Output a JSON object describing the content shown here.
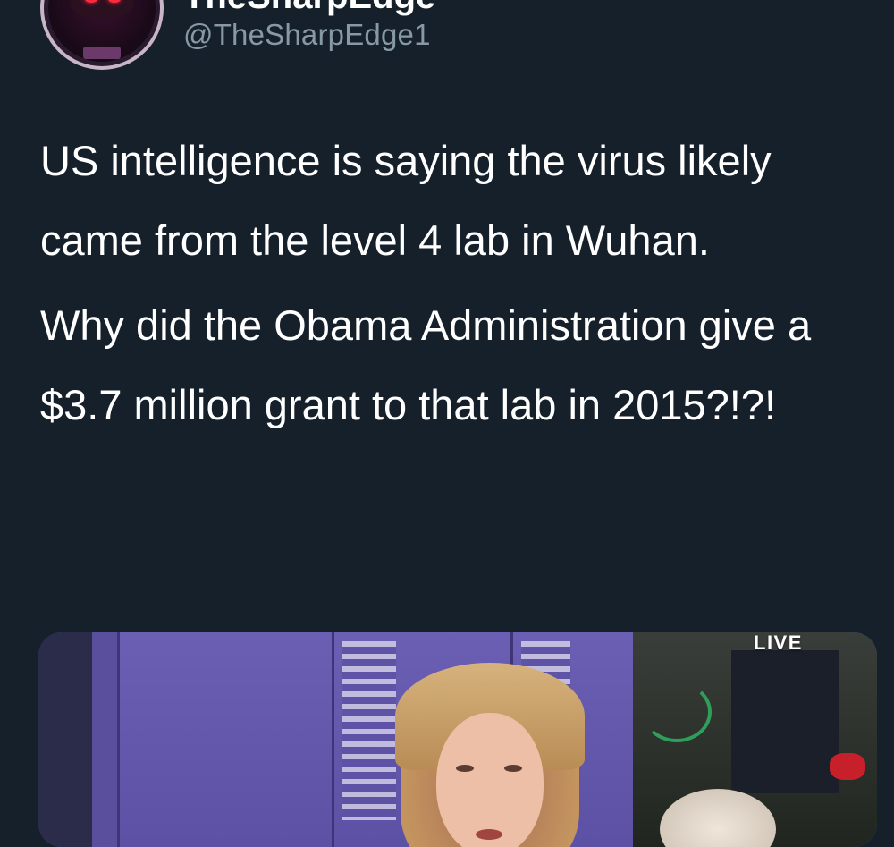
{
  "tweet": {
    "display_name": "TheSharpEdge",
    "handle": "@TheSharpEdge1",
    "avatar_icon": "masked-figure-avatar",
    "paragraphs": [
      "US intelligence is saying the virus likely came from the level 4 lab in Wuhan.",
      "Why did the Obama Administration give a $3.7 million grant to that lab in 2015?!?!"
    ]
  },
  "media": {
    "badge": "LIVE"
  },
  "colors": {
    "background": "#15202b",
    "text": "#ffffff",
    "handle": "#8899a6"
  }
}
